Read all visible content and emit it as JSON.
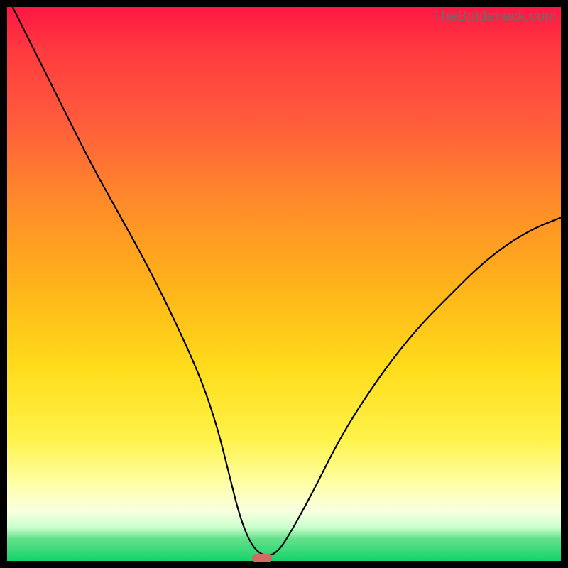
{
  "watermark": "TheBottleneck.com",
  "colors": {
    "frame": "#000000",
    "gradient_top": "#ff1744",
    "gradient_mid": "#ffdc1a",
    "gradient_bottom": "#14d46a",
    "curve": "#000000",
    "marker": "#d36b63",
    "watermark_text": "#6b6b6b"
  },
  "chart_data": {
    "type": "line",
    "title": "",
    "xlabel": "",
    "ylabel": "",
    "xlim": [
      0,
      100
    ],
    "ylim": [
      0,
      100
    ],
    "x": [
      1,
      5,
      10,
      15,
      20,
      25,
      30,
      35,
      38,
      40,
      42,
      44,
      46,
      48,
      50,
      55,
      60,
      65,
      70,
      75,
      80,
      85,
      90,
      95,
      100
    ],
    "values": [
      100,
      92,
      82,
      72,
      63,
      54,
      44,
      33,
      24,
      16,
      8,
      3,
      1,
      1,
      3,
      12,
      22,
      30,
      37,
      43,
      48,
      53,
      57,
      60,
      62
    ],
    "marker": {
      "x": 46,
      "y": 0.5
    },
    "notes": "Values are approximate percentages read from a V-shaped bottleneck curve with minimum near x≈46. Y axis: 0 at bottom (green), 100 at top (red)."
  }
}
